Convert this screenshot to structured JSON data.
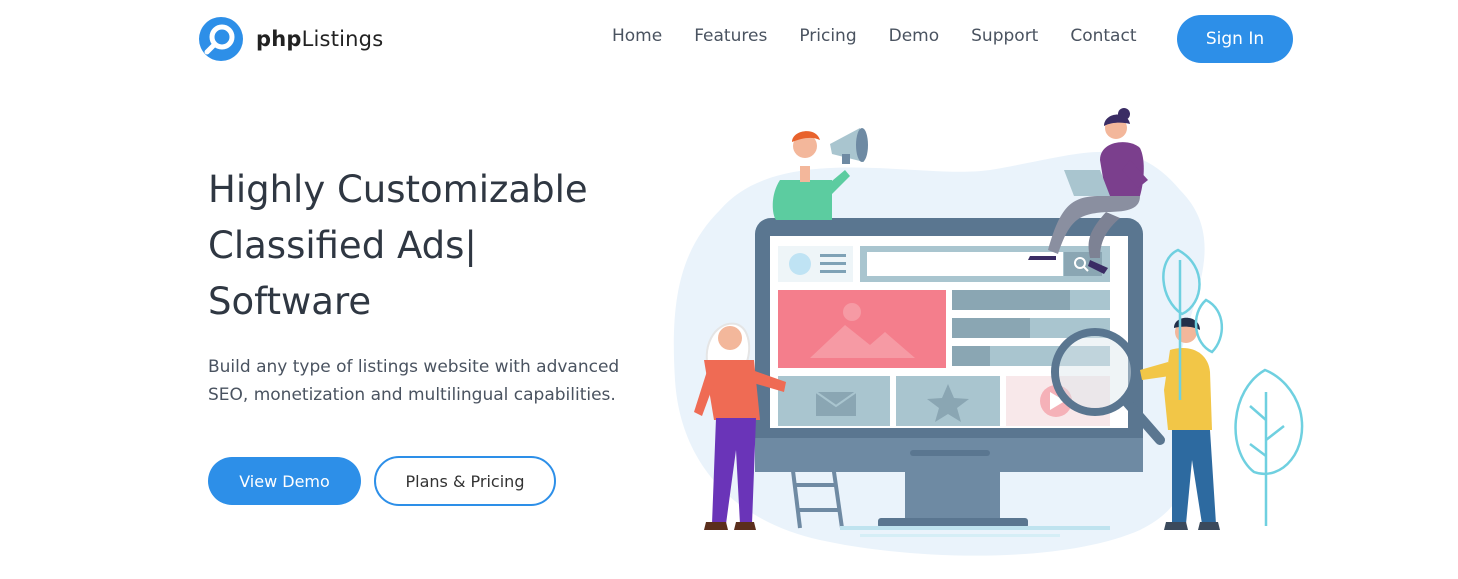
{
  "brand": {
    "bold": "php",
    "regular": "Listings"
  },
  "nav": [
    "Home",
    "Features",
    "Pricing",
    "Demo",
    "Support",
    "Contact"
  ],
  "signin_label": "Sign In",
  "hero": {
    "title_line1": "Highly Customizable",
    "title_line2": "Classified Ads",
    "title_cursor": "|",
    "title_line3": "Software",
    "description": "Build any type of listings website with advanced SEO, monetization and multilingual capabilities."
  },
  "cta": {
    "demo": "View Demo",
    "plans": "Plans & Pricing"
  },
  "colors": {
    "accent": "#2d8fe8",
    "heading": "#2f3742",
    "body": "#4a5360"
  }
}
